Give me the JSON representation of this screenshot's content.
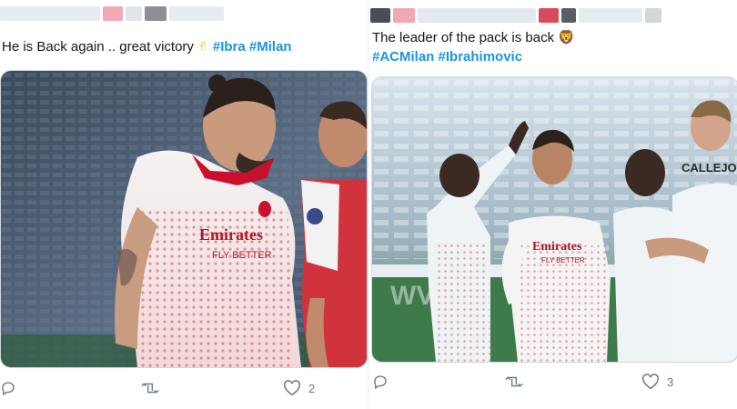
{
  "tweets": [
    {
      "text": "He is Back again .. great victory",
      "emoji": "✌",
      "hashtags": [
        "#Ibra",
        "#Milan"
      ],
      "actions": {
        "reply_count": "",
        "retweet_count": "",
        "like_count": "2"
      },
      "media": {
        "sponsor": "Emirates",
        "sponsor_sub": "FLY BETTER"
      }
    },
    {
      "text": "The leader of the pack is back",
      "emoji": "🦁",
      "hashtags": [
        "#ACMilan",
        "#Ibrahimovic"
      ],
      "actions": {
        "reply_count": "",
        "retweet_count": "",
        "like_count": "3"
      },
      "media": {
        "sponsor": "Emirates",
        "sponsor_sub": "FLY BETTER",
        "shirt_name": "CALLEJO"
      }
    }
  ],
  "colors": {
    "hashtag": "#1b95e0",
    "action_icon": "#657786",
    "milan_red": "#c8102e",
    "pitch_green": "#3f7a4a"
  }
}
